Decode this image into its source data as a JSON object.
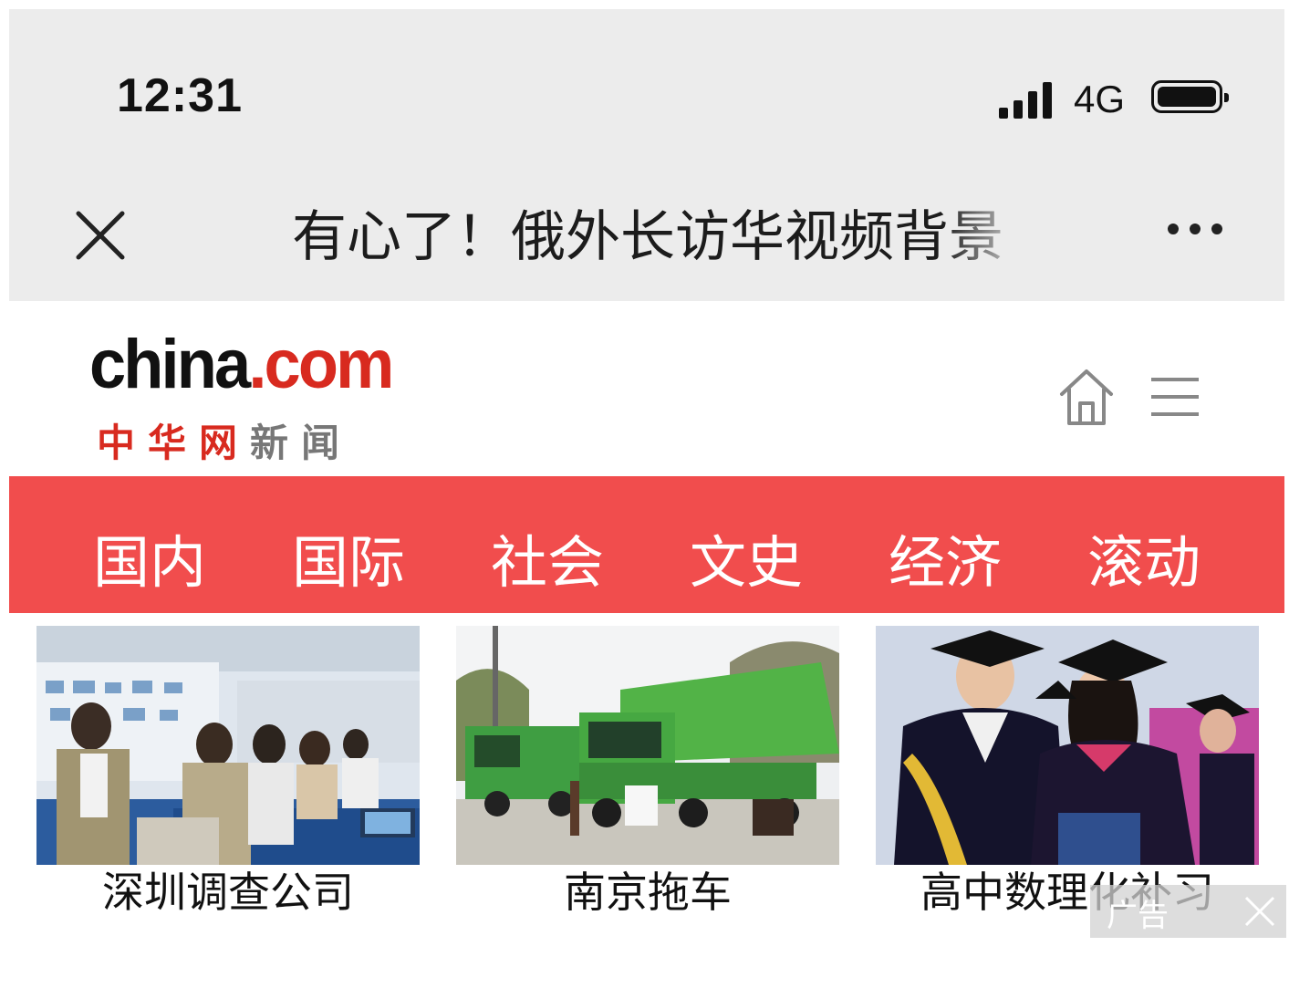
{
  "status_bar": {
    "time": "12:31",
    "network": "4G"
  },
  "title_bar": {
    "title": "有心了！俄外长访华视频背景"
  },
  "site": {
    "logo": {
      "main_dark": "china",
      "main_red": ".com",
      "sub_red": "中华网",
      "sub_grey": "新闻"
    }
  },
  "nav": {
    "items": [
      "国内",
      "国际",
      "社会",
      "文史",
      "经济",
      "滚动"
    ]
  },
  "ads": {
    "cards": [
      {
        "caption": "深圳调查公司",
        "image": "office-photo"
      },
      {
        "caption": "南京拖车",
        "image": "green-trucks-photo"
      },
      {
        "caption": "高中数理化补习",
        "image": "graduation-photo"
      }
    ],
    "ad_label": "广告"
  },
  "icons": [
    "close-icon",
    "more-icon",
    "home-icon",
    "menu-icon",
    "signal-icon",
    "battery-icon"
  ],
  "colors": {
    "accent_red": "#f14d4d",
    "logo_red": "#d82a1f",
    "bar_grey": "#ececec"
  }
}
